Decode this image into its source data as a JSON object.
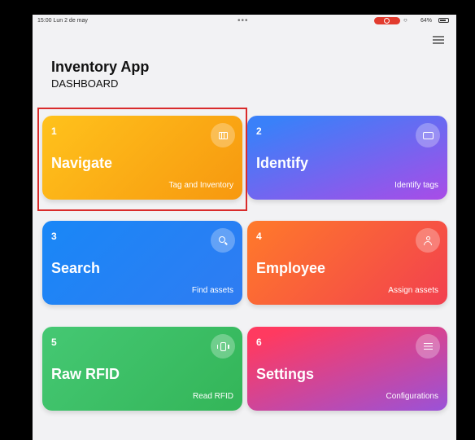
{
  "status_bar": {
    "time": "15:00  Lun 2 de may",
    "dots": "•••",
    "battery": "64%"
  },
  "header": {
    "title": "Inventory App",
    "subtitle": "DASHBOARD"
  },
  "icons": {
    "menu": "hamburger-menu-icon",
    "wifi": "wifi-icon",
    "battery": "battery-icon"
  },
  "cards": [
    {
      "number": "1",
      "title": "Navigate",
      "subtitle": "Tag and Inventory",
      "icon": "map-icon",
      "gradient": [
        "#ffbc17",
        "#f99b10"
      ]
    },
    {
      "number": "2",
      "title": "Identify",
      "subtitle": "Identify tags",
      "icon": "screen-icon",
      "gradient": [
        "#3b7df8",
        "#b24ae6"
      ]
    },
    {
      "number": "3",
      "title": "Search",
      "subtitle": "Find assets",
      "icon": "search-icon",
      "gradient": [
        "#1c82f5",
        "#2f7ff3"
      ]
    },
    {
      "number": "4",
      "title": "Employee",
      "subtitle": "Assign assets",
      "icon": "person-icon",
      "gradient": [
        "#ff6f2b",
        "#f5424c"
      ]
    },
    {
      "number": "5",
      "title": "Raw RFID",
      "subtitle": "Read RFID",
      "icon": "vibrate-icon",
      "gradient": [
        "#3ec26b",
        "#36b85b"
      ]
    },
    {
      "number": "6",
      "title": "Settings",
      "subtitle": "Configurations",
      "icon": "sliders-icon",
      "gradient": [
        "#ff3d64",
        "#9b4fd6"
      ]
    }
  ],
  "colors": {
    "highlight_border": "#d92b2b",
    "screen_background": "#f2f2f4",
    "recording_pill": "#e23b2e"
  }
}
